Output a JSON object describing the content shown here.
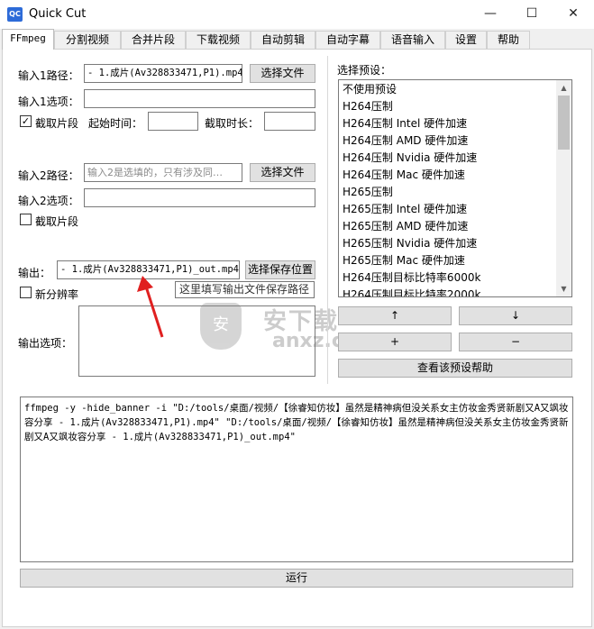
{
  "window": {
    "title": "Quick Cut",
    "icon_text": "QC",
    "minimize": "—",
    "maximize": "☐",
    "close": "✕"
  },
  "tabs": [
    {
      "label": "FFmpeg",
      "active": true
    },
    {
      "label": "分割视频"
    },
    {
      "label": "合并片段"
    },
    {
      "label": "下载视频"
    },
    {
      "label": "自动剪辑"
    },
    {
      "label": "自动字幕"
    },
    {
      "label": "语音输入"
    },
    {
      "label": "设置"
    },
    {
      "label": "帮助"
    }
  ],
  "input1": {
    "path_label": "输入1路径：",
    "path_value": "- 1.成片(Av328833471,P1).mp4",
    "choose_button": "选择文件",
    "options_label": "输入1选项：",
    "options_value": "",
    "clip_checkbox_label": "截取片段",
    "clip_checked": true,
    "start_label": "起始时间：",
    "start_value": "",
    "duration_label": "截取时长：",
    "duration_value": ""
  },
  "input2": {
    "path_label": "输入2路径：",
    "path_placeholder": "输入2是选填的，只有涉及同…",
    "choose_button": "选择文件",
    "options_label": "输入2选项：",
    "options_value": "",
    "clip_checkbox_label": "截取片段",
    "clip_checked": false
  },
  "output": {
    "label": "输出：",
    "value": "- 1.成片(Av328833471,P1)_out.mp4",
    "save_button": "选择保存位置",
    "tooltip": "这里填写输出文件保存路径",
    "new_resolution_label": "新分辨率",
    "new_resolution_checked": false,
    "options_label": "输出选项：",
    "options_value": ""
  },
  "presets": {
    "label": "选择预设：",
    "items": [
      "不使用预设",
      "H264压制",
      "H264压制 Intel 硬件加速",
      "H264压制 AMD 硬件加速",
      "H264压制 Nvidia 硬件加速",
      "H264压制 Mac 硬件加速",
      "H265压制",
      "H265压制 Intel 硬件加速",
      "H265压制 AMD 硬件加速",
      "H265压制 Nvidia 硬件加速",
      "H265压制 Mac 硬件加速",
      "H264压制目标比特率6000k",
      "H264压制目标比特率2000k"
    ],
    "move_up": "↑",
    "move_down": "↓",
    "add": "+",
    "remove": "−",
    "help_button": "查看该预设帮助"
  },
  "command": {
    "text": "ffmpeg -y -hide_banner -i \"D:/tools/桌面/视频/【徐睿知仿妆】虽然是精神病但没关系女主仿妆金秀贤新剧又A又飒妆容分享 - 1.成片(Av328833471,P1).mp4\" \"D:/tools/桌面/视频/【徐睿知仿妆】虽然是精神病但没关系女主仿妆金秀贤新剧又A又飒妆容分享 - 1.成片(Av328833471,P1)_out.mp4\""
  },
  "run_button": "运行",
  "watermark": {
    "text": "安下载",
    "sub": "anxz.com"
  }
}
